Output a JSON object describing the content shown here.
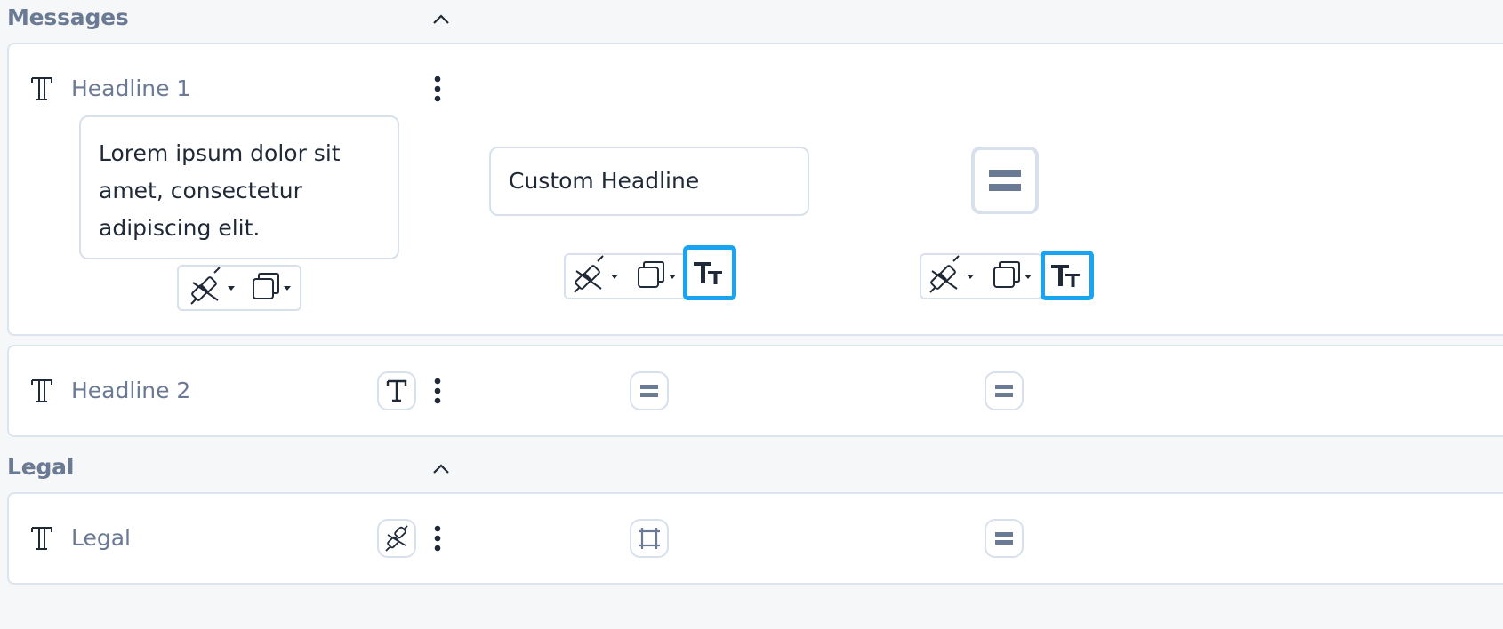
{
  "sections": {
    "messages": {
      "title": "Messages"
    },
    "legal": {
      "title": "Legal"
    }
  },
  "rows": {
    "headline1": {
      "label": "Headline 1",
      "body_text": "Lorem ipsum dolor sit amet, consectetur adipiscing elit.",
      "custom_input_value": "Custom Headline"
    },
    "headline2": {
      "label": "Headline 2"
    },
    "legal": {
      "label": "Legal"
    }
  },
  "colors": {
    "accent": "#1aa3f0",
    "label_gray": "#6b7a94",
    "border": "#d7e0ec",
    "background": "#f6f7f9"
  },
  "icons": [
    "chevron-up-icon",
    "text-type-icon",
    "more-vertical-icon",
    "unlink-icon",
    "copy-icon",
    "text-size-icon",
    "equals-icon",
    "crop-frame-icon",
    "caret-down-icon"
  ]
}
